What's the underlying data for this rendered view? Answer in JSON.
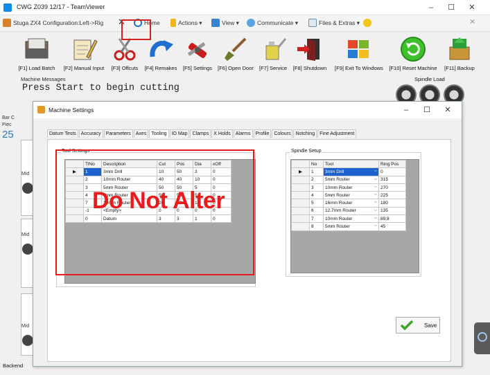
{
  "window": {
    "title": "CWG Z039 12/17 - TeamViewer",
    "minimize": "–",
    "maximize": "☐",
    "close": "✕"
  },
  "teamviewer_toolbar": {
    "session_tab": "Stuga ZX4   Configuration:Left->Rig",
    "close_session": "✕",
    "home": "Home",
    "actions": "Actions ▾",
    "view": "View ▾",
    "communicate": "Communicate ▾",
    "files_extras": "Files & Extras ▾",
    "toolbar_close": "✕"
  },
  "function_keys": [
    {
      "label": "[F1] Load Batch",
      "icon": "folder-icon"
    },
    {
      "label": "[F2] Manual Input",
      "icon": "notepad-icon"
    },
    {
      "label": "[F3] Offcuts",
      "icon": "scissors-icon"
    },
    {
      "label": "[F4] Remakes",
      "icon": "redo-arrow-icon"
    },
    {
      "label": "[F5] Settings",
      "icon": "tools-icon"
    },
    {
      "label": "[F6] Open Door",
      "icon": "brush-icon"
    },
    {
      "label": "[F7] Service",
      "icon": "oil-can-icon"
    },
    {
      "label": "[F8] Shutdown",
      "icon": "exit-door-icon"
    },
    {
      "label": "[F9] Exit To Windows",
      "icon": "windows-logo-icon"
    },
    {
      "label": "[F10] Reset Machine",
      "icon": "reset-icon"
    },
    {
      "label": "[F11] Backup",
      "icon": "backup-box-icon"
    }
  ],
  "machine_messages": {
    "label": "Machine Messages",
    "text": "Press Start to begin cutting"
  },
  "spindle_load_label": "Spindle Load",
  "left_strip": {
    "bar_label": "Bar C",
    "piece_label": "Piec",
    "count": "25",
    "mid_labels": [
      "Mid",
      "Mid",
      "Mid"
    ]
  },
  "backend_label": "Backend",
  "dialog": {
    "title": "Machine Settings",
    "minimize": "–",
    "maximize": "☐",
    "close": "✕",
    "tabs": [
      "Datum Tests",
      "Accuracy",
      "Parameters",
      "Axes",
      "Tooling",
      "IO Map",
      "Clamps",
      "X Holds",
      "Alarms",
      "Profile",
      "Colours",
      "Notching",
      "Fine Adjustment"
    ],
    "active_tab": "Tooling",
    "tool_settings": {
      "label": "Tool Settings",
      "columns": [
        "TlNo",
        "Description",
        "Cut",
        "Pos",
        "Dia",
        "xOff"
      ],
      "current_row_marker": "▶",
      "rows": [
        {
          "tlno": "1",
          "description": "3mm Drill",
          "cut": "10",
          "pos": "50",
          "dia": "3",
          "xoff": "0"
        },
        {
          "tlno": "2",
          "description": "10mm Router",
          "cut": "40",
          "pos": "40",
          "dia": "10",
          "xoff": "0"
        },
        {
          "tlno": "3",
          "description": "5mm Router",
          "cut": "50",
          "pos": "50",
          "dia": "5",
          "xoff": "0"
        },
        {
          "tlno": "4",
          "description": "5mm Router",
          "cut": "50",
          "pos": "50",
          "dia": "5",
          "xoff": "0"
        },
        {
          "tlno": "7",
          "description": "10mm Router",
          "cut": "20",
          "pos": "20",
          "dia": "10",
          "xoff": "0"
        },
        {
          "tlno": "-1",
          "description": "<Empty>",
          "cut": "0",
          "pos": "0",
          "dia": "0",
          "xoff": "0"
        },
        {
          "tlno": "0",
          "description": "Datum",
          "cut": "3",
          "pos": "3",
          "dia": "1",
          "xoff": "0"
        }
      ]
    },
    "spindle_setup": {
      "label": "Spindle Setup",
      "columns": [
        "No",
        "Tool",
        "Ring Pos"
      ],
      "current_row_marker": "▶",
      "dropdown_arrow": "⌵",
      "rows": [
        {
          "no": "1",
          "tool": "3mm Drill",
          "ring_pos": "0"
        },
        {
          "no": "2",
          "tool": "5mm Router",
          "ring_pos": "315"
        },
        {
          "no": "3",
          "tool": "10mm Router",
          "ring_pos": "270"
        },
        {
          "no": "4",
          "tool": "5mm Router",
          "ring_pos": "225"
        },
        {
          "no": "5",
          "tool": "16mm Router",
          "ring_pos": "180"
        },
        {
          "no": "6",
          "tool": "12.7mm Router",
          "ring_pos": "135"
        },
        {
          "no": "7",
          "tool": "10mm Router",
          "ring_pos": "89.8"
        },
        {
          "no": "8",
          "tool": "5mm Router",
          "ring_pos": "45"
        }
      ]
    },
    "save_label": "Save"
  },
  "annotation": {
    "text": "Do Not Alter",
    "color": "#e81c1c"
  }
}
